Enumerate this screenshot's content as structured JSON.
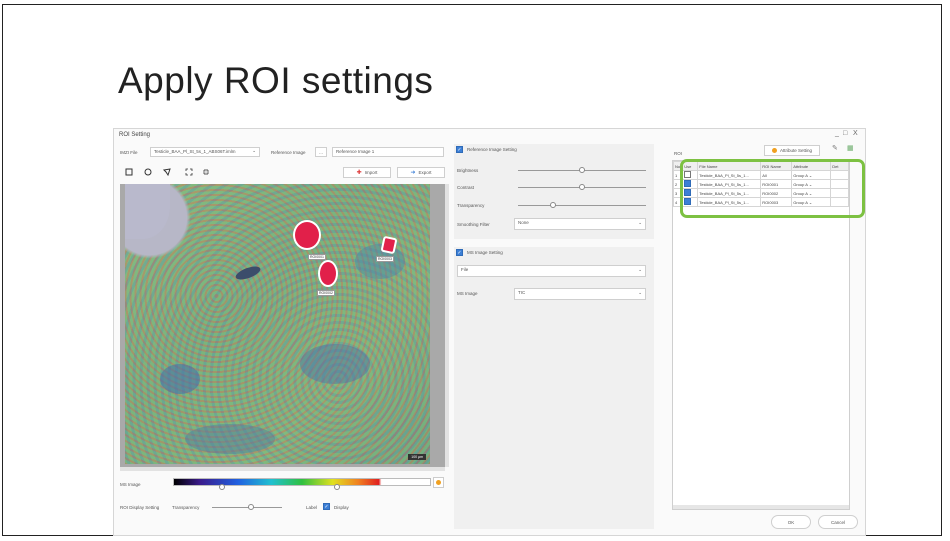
{
  "slide": {
    "title": "Apply ROI settings"
  },
  "window": {
    "title": "ROI Setting",
    "minimize": "_",
    "maximize": "□",
    "close": "X"
  },
  "header": {
    "imzml_label": "IMZI File",
    "imzml_value": "Testicle_BAA_Pl_St_5s_1_ABS06T.imlm",
    "reference_label": "Reference Image",
    "reference_browse": "...",
    "reference_value": "Reference Image 1"
  },
  "toolbar": {
    "import_label": "Import",
    "export_label": "Export"
  },
  "image": {
    "scale_label": "100 µm",
    "rois": [
      {
        "label": "ROI0001"
      },
      {
        "label": "ROI0002"
      },
      {
        "label": "ROI0003"
      }
    ]
  },
  "ms_image_bar": {
    "label": "MS Image"
  },
  "roi_display": {
    "label": "ROI Display Setting",
    "transparency_label": "Transparency",
    "label_label": "Label",
    "display_label": "Display",
    "display_checked": true
  },
  "reference_settings": {
    "title": "Reference Image Setting",
    "enabled": true,
    "brightness_label": "Brightness",
    "contrast_label": "Contrast",
    "transparency_label": "Transparency",
    "smoothing_label": "Smoothing Filter",
    "smoothing_value": "None"
  },
  "ms_settings": {
    "title": "MS Image Setting",
    "enabled": true,
    "mode_value": "File",
    "ms_image_label": "MS Image",
    "ms_image_value": "TIC"
  },
  "roi_grid": {
    "title": "ROI",
    "attribute_button": "Attribute Setting",
    "columns": [
      "No.",
      "Use",
      "File Name",
      "ROI Name",
      "Attribute",
      "Det"
    ],
    "rows": [
      {
        "no": "1",
        "use": false,
        "file": "Testicle_BAA_Pl_St_5s_1...",
        "roi": "All",
        "attribute": "Group A"
      },
      {
        "no": "2",
        "use": true,
        "file": "Testicle_BAA_Pl_St_5s_1...",
        "roi": "ROI0001",
        "attribute": "Group A"
      },
      {
        "no": "3",
        "use": true,
        "file": "Testicle_BAA_Pl_St_5s_1...",
        "roi": "ROI0002",
        "attribute": "Group A"
      },
      {
        "no": "4",
        "use": true,
        "file": "Testicle_BAA_Pl_St_5s_1...",
        "roi": "ROI0003",
        "attribute": "Group A"
      }
    ]
  },
  "footer": {
    "ok_label": "OK",
    "cancel_label": "Cancel"
  },
  "colors": {
    "highlight": "#7dc142",
    "roi": "#e1204a",
    "checkbox": "#3c7fd6"
  }
}
